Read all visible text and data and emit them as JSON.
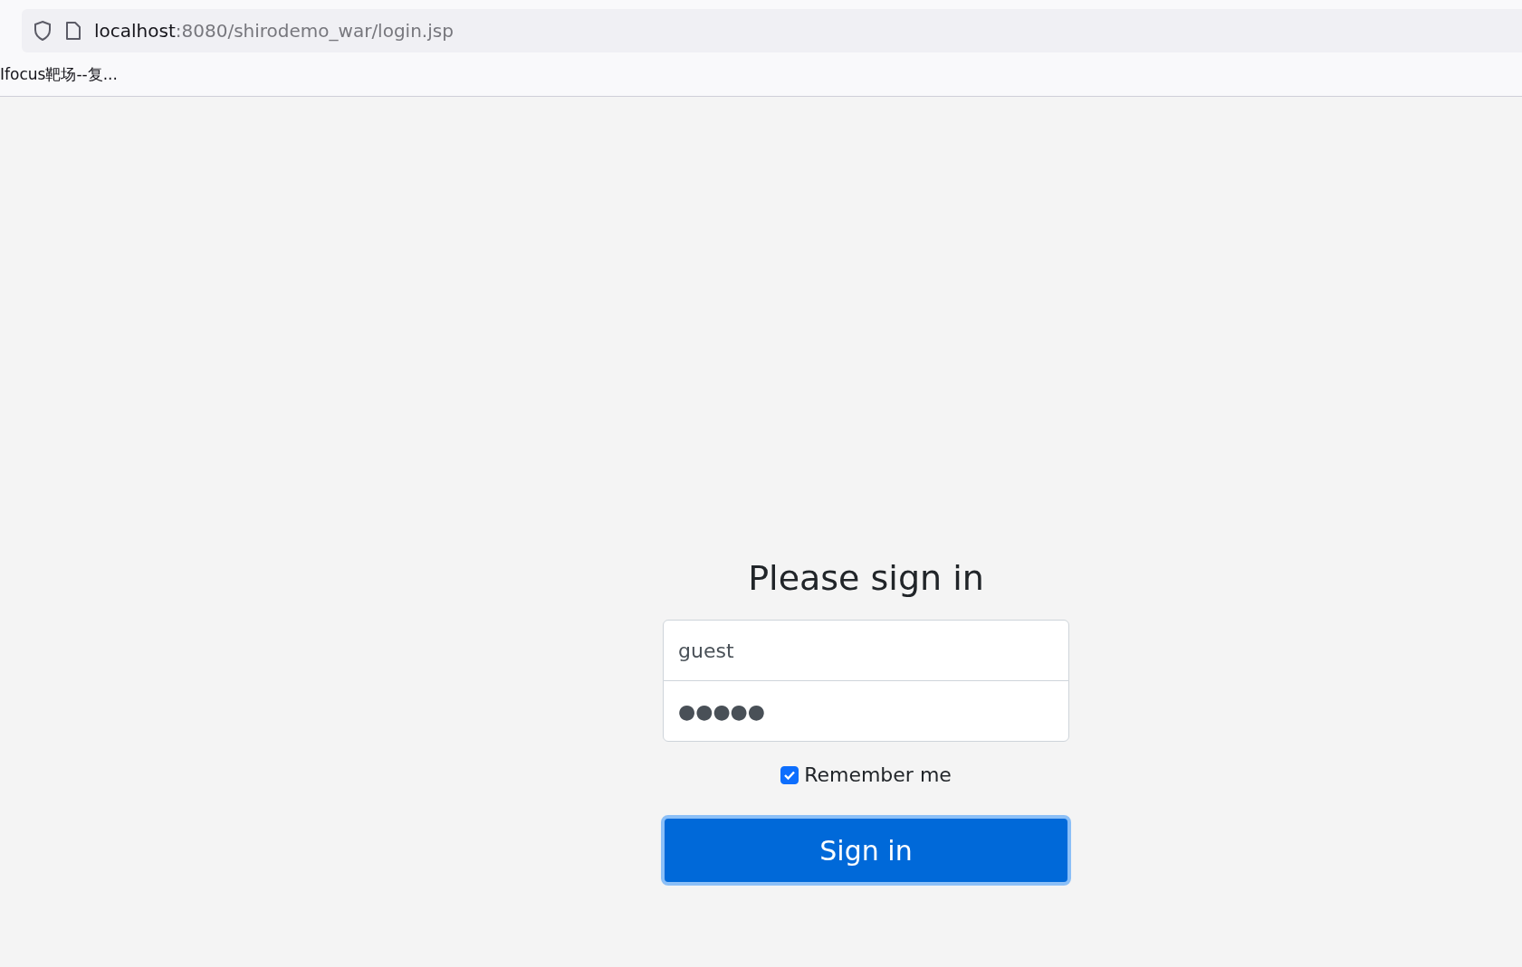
{
  "address_bar": {
    "host": "localhost",
    "path": ":8080/shirodemo_war/login.jsp"
  },
  "bookmarks": [
    {
      "label": "Ifocus靶场--复..."
    }
  ],
  "form": {
    "title": "Please sign in",
    "username": "guest",
    "password": "●●●●●",
    "remember": {
      "label": "Remember me",
      "checked": true
    },
    "submit": "Sign in"
  }
}
